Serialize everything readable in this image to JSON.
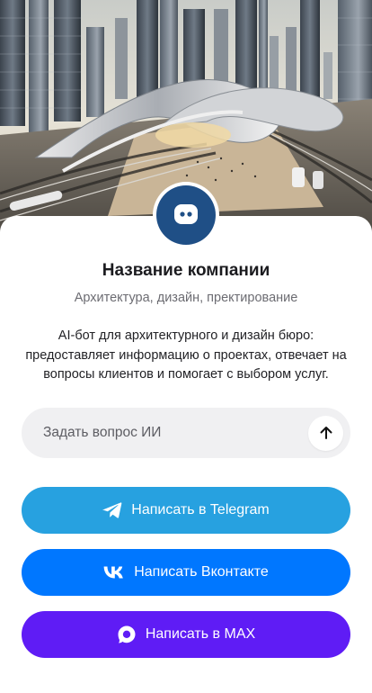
{
  "company": {
    "name": "Название компании",
    "subtitle": "Архитектура, дизайн, пректирование",
    "description": "AI-бот для архитектурного и дизайн бюро: предоставляет информацию о проектах, отвечает на вопросы клиентов и помогает с выбором услуг."
  },
  "hero": {
    "icon": "architecture-city-illustration"
  },
  "avatar": {
    "icon": "chat-bot-icon",
    "color": "#1f4f86"
  },
  "ask": {
    "placeholder": "Задать вопрос ИИ",
    "send_icon": "arrow-up-icon"
  },
  "buttons": {
    "telegram": {
      "label": "Написать в Telegram",
      "icon": "telegram-icon",
      "color": "#27a1e0"
    },
    "vk": {
      "label": "Написать Вконтакте",
      "icon": "vk-icon",
      "color": "#0077ff"
    },
    "max": {
      "label": "Написать в MAX",
      "icon": "max-icon",
      "color": "#5f1cf5"
    }
  }
}
